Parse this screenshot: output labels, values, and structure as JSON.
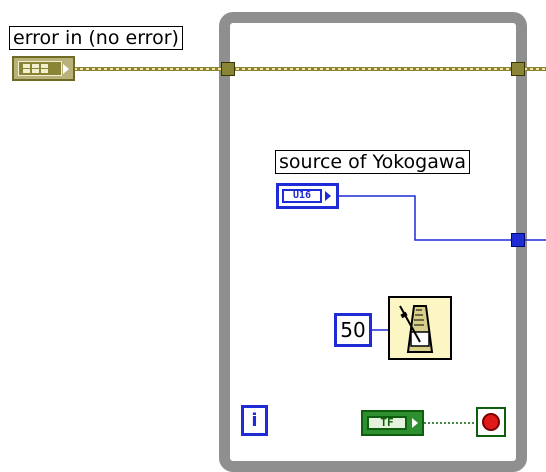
{
  "diagram": {
    "error_in": {
      "label": "error in (no error)"
    },
    "source_control": {
      "label": "source of Yokogawa",
      "type_text": "U16"
    },
    "wait_constant": {
      "value": "50"
    },
    "iteration_terminal": {
      "glyph": "i"
    },
    "stop_control": {
      "type_text": "TF"
    },
    "colors": {
      "loop_frame": "#8f8f8f",
      "cluster_wire": "#8a8436",
      "numeric_wire": "#1f2bd4",
      "boolean_wire": "#0d5f0d",
      "stop_red": "#e11919"
    },
    "icons": {
      "wait_function": "metronome-icon",
      "stop_terminal": "stop-icon"
    }
  }
}
